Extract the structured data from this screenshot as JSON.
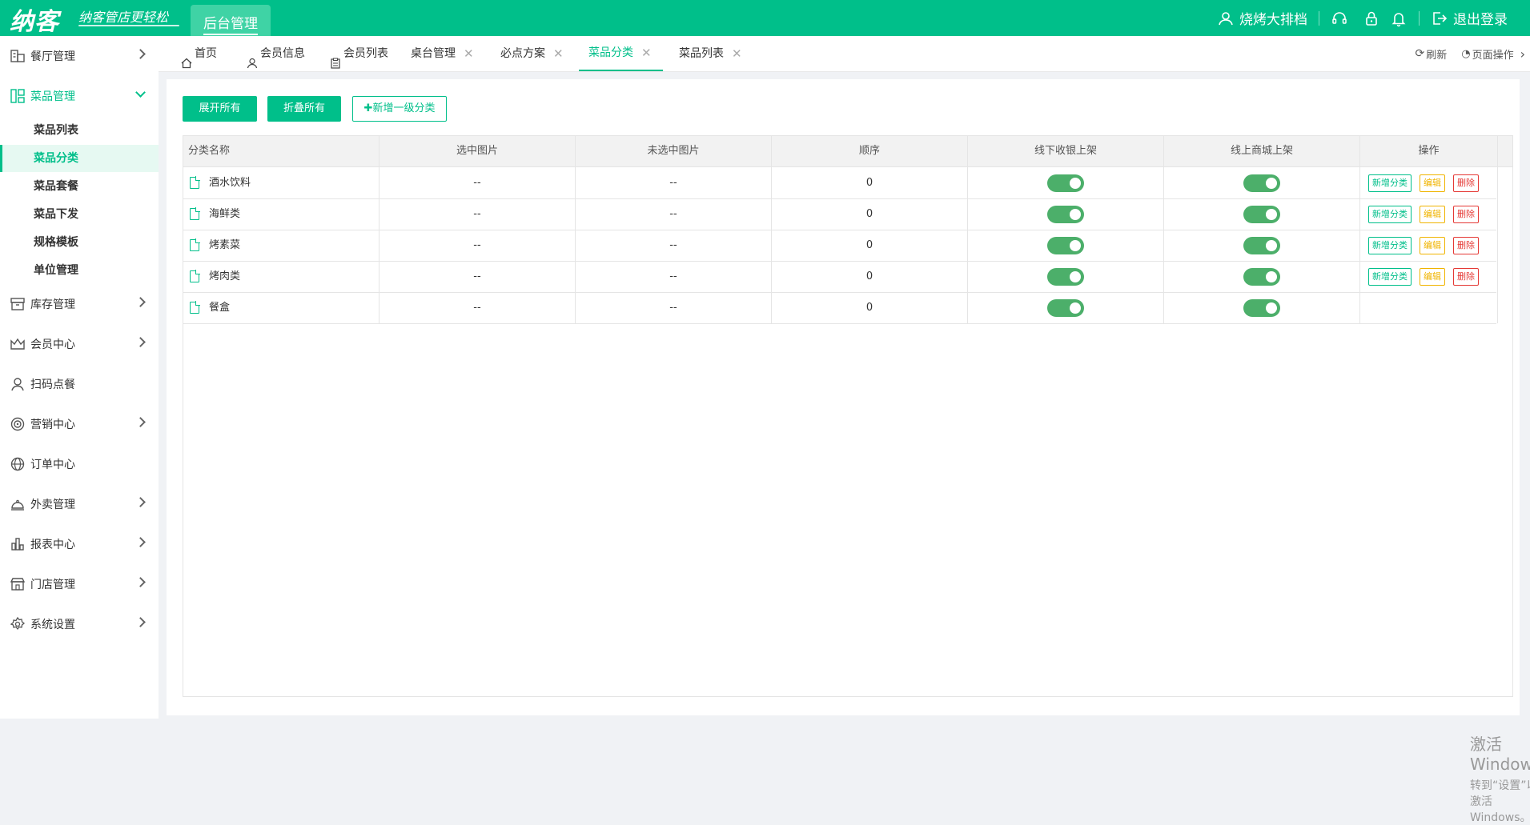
{
  "header": {
    "logo": "纳客",
    "slogan": "纳客管店更轻松",
    "active_module": "后台管理",
    "user_name": "烧烤大排档",
    "logout": "退出登录"
  },
  "sidebar": {
    "items": [
      {
        "label": "餐厅管理",
        "icon": "restaurant-icon"
      },
      {
        "label": "菜品管理",
        "icon": "dishes-icon"
      },
      {
        "label": "库存管理",
        "icon": "inventory-icon"
      },
      {
        "label": "会员中心",
        "icon": "crown-icon"
      },
      {
        "label": "扫码点餐",
        "icon": "user-icon"
      },
      {
        "label": "营销中心",
        "icon": "target-icon"
      },
      {
        "label": "订单中心",
        "icon": "globe-icon"
      },
      {
        "label": "外卖管理",
        "icon": "cloche-icon"
      },
      {
        "label": "报表中心",
        "icon": "bar-chart-icon"
      },
      {
        "label": "门店管理",
        "icon": "store-icon"
      },
      {
        "label": "系统设置",
        "icon": "gear-icon"
      }
    ],
    "sub_items": [
      "菜品列表",
      "菜品分类",
      "菜品套餐",
      "菜品下发",
      "规格模板",
      "单位管理"
    ]
  },
  "tabs": {
    "items": [
      "首页",
      "会员信息",
      "会员列表",
      "桌台管理",
      "必点方案",
      "菜品分类",
      "菜品列表"
    ],
    "refresh": "刷新",
    "page_ops": "页面操作"
  },
  "toolbar": {
    "expand_all": "展开所有",
    "collapse_all": "折叠所有",
    "add_top": "✚新增一级分类"
  },
  "table": {
    "headers": [
      "分类名称",
      "选中图片",
      "未选中图片",
      "顺序",
      "线下收银上架",
      "线上商城上架",
      "操作"
    ],
    "rows": [
      {
        "name": "酒水饮料",
        "selected_img": "--",
        "unselected_img": "--",
        "order": "0",
        "offline_on": true,
        "online_on": true
      },
      {
        "name": "海鲜类",
        "selected_img": "--",
        "unselected_img": "--",
        "order": "0",
        "offline_on": true,
        "online_on": true
      },
      {
        "name": "烤素菜",
        "selected_img": "--",
        "unselected_img": "--",
        "order": "0",
        "offline_on": true,
        "online_on": true
      },
      {
        "name": "烤肉类",
        "selected_img": "--",
        "unselected_img": "--",
        "order": "0",
        "offline_on": true,
        "online_on": true
      },
      {
        "name": "餐盒",
        "selected_img": "--",
        "unselected_img": "--",
        "order": "0",
        "offline_on": true,
        "online_on": true
      }
    ],
    "ops": {
      "add": "新增分类",
      "edit": "编辑",
      "delete": "删除"
    }
  },
  "watermark": {
    "line1": "激活 Windows",
    "line2": "转到“设置”以激活 Windows。"
  },
  "colors": {
    "brand": "#00bf8a",
    "toggle_on": "#4caf6a",
    "edit": "#f0b400",
    "delete": "#e53935"
  }
}
